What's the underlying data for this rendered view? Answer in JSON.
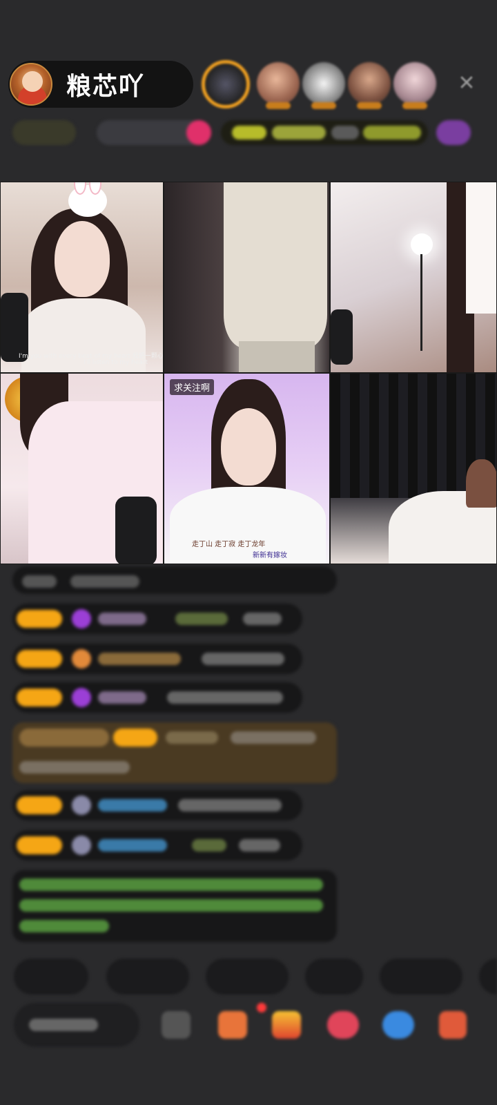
{
  "header": {
    "host_name": "粮芯吖",
    "close_icon": "close-icon"
  },
  "grid": {
    "tile5_tag": "求关注啊",
    "tile5_caption_1": "走丁山 走丁寂 走丁龙年",
    "tile5_caption_2": "新新有嫁妆",
    "tile1_caption_1": "I'm you with every beat of my heart 我把一颗心都给了你",
    "tile1_caption_2": "I'll listen to my heart"
  },
  "colors": {
    "background": "#2a2a2c",
    "accent_orange": "#f0a021",
    "level_badge": "#f5a615",
    "gem_purple": "#9b3fd6",
    "chat_green": "#6fbf4a",
    "chat_blue": "#4aa8d8"
  }
}
